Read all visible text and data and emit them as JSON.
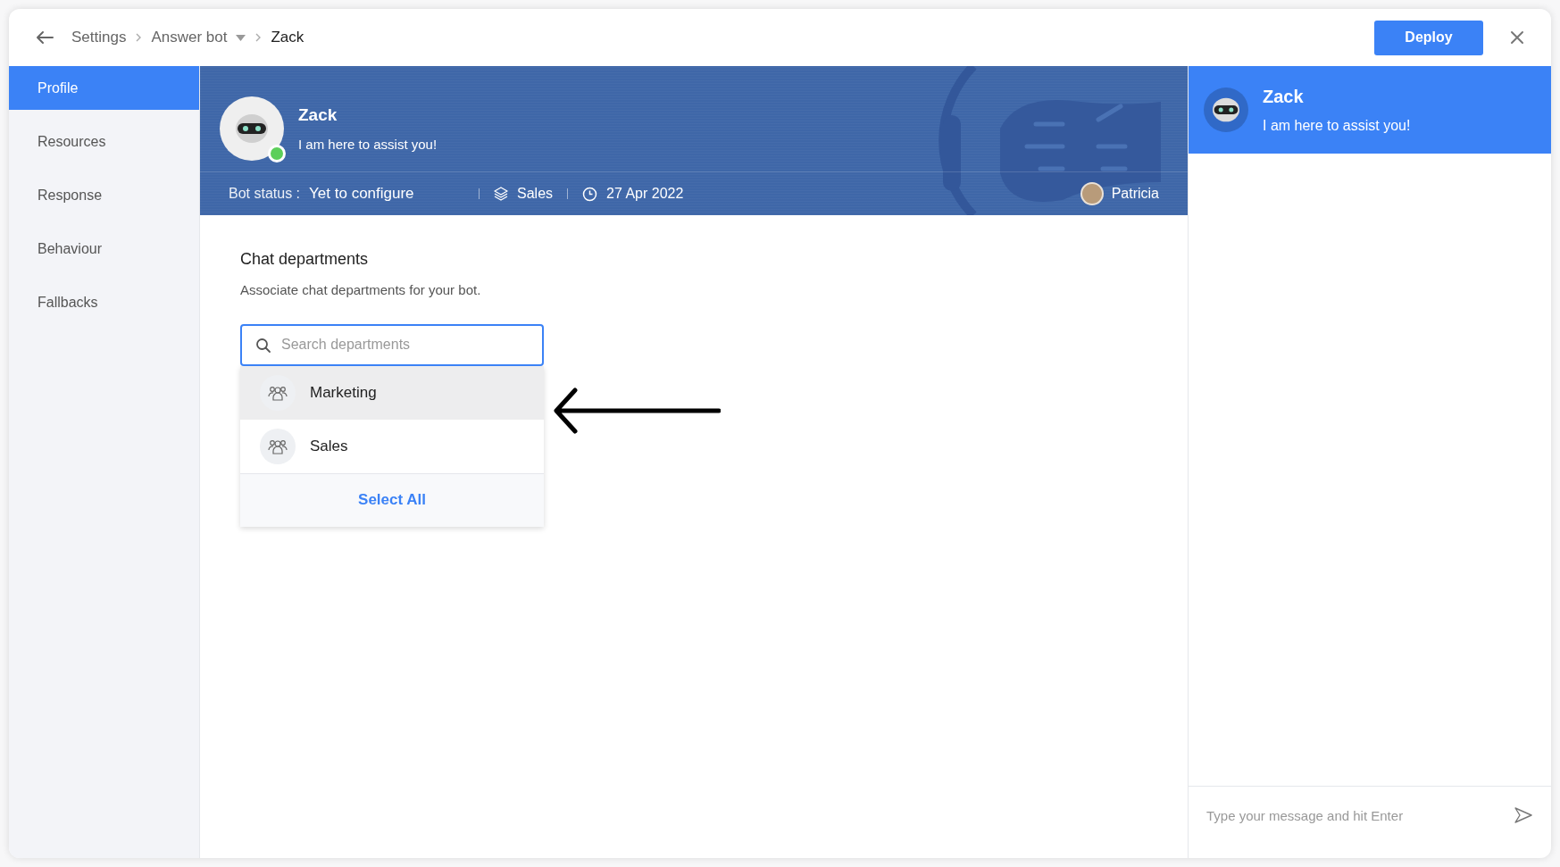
{
  "breadcrumb": {
    "items": [
      {
        "label": "Settings",
        "kind": "link"
      },
      {
        "label": "Answer bot",
        "kind": "dropdown"
      },
      {
        "label": "Zack",
        "kind": "current"
      }
    ]
  },
  "deploy_button": "Deploy",
  "sidebar": {
    "items": [
      {
        "label": "Profile",
        "selected": true
      },
      {
        "label": "Resources",
        "selected": false
      },
      {
        "label": "Response",
        "selected": false
      },
      {
        "label": "Behaviour",
        "selected": false
      },
      {
        "label": "Fallbacks",
        "selected": false
      }
    ]
  },
  "banner": {
    "name": "Zack",
    "tagline": "I am here to assist you!",
    "online": true,
    "status_label": "Bot status :",
    "status_value": "Yet to configure",
    "department": "Sales",
    "date": "27 Apr 2022",
    "owner": "Patricia"
  },
  "section": {
    "title": "Chat departments",
    "description": "Associate chat departments for your bot."
  },
  "search": {
    "placeholder": "Search departments"
  },
  "departments": [
    {
      "name": "Marketing",
      "selected": true
    },
    {
      "name": "Sales",
      "selected": false
    }
  ],
  "select_all": "Select All",
  "preview": {
    "name": "Zack",
    "tagline": "I am here to assist you!",
    "placeholder": "Type your message and hit Enter"
  }
}
